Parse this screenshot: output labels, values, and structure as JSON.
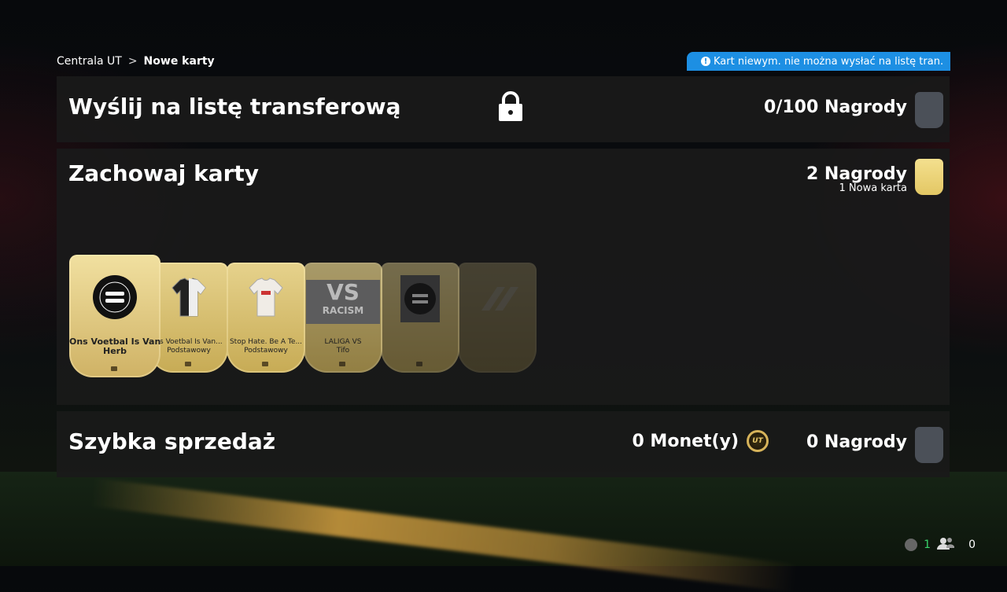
{
  "breadcrumb": {
    "root": "Centrala UT",
    "current": "Nowe karty"
  },
  "notice": {
    "text": "Kart niewym. nie można wysłać na listę tran."
  },
  "transfer_panel": {
    "title": "Wyślij na listę transferową",
    "rewards": "0/100 Nagrody",
    "locked": true
  },
  "keep_panel": {
    "title": "Zachowaj karty",
    "rewards": "2 Nagrody",
    "new_cards": "1 Nowa karta",
    "cards": [
      {
        "name": "Ons Voetbal Is Van...",
        "kind": "Herb",
        "image": "club-crest-icon"
      },
      {
        "name": "ns Voetbal Is Van...",
        "kind": "Podstawowy",
        "image": "kit-icon"
      },
      {
        "name": "Stop Hate. Be A Te...",
        "kind": "Podstawowy",
        "image": "kit-icon"
      },
      {
        "name": "LALIGA VS",
        "kind": "Tifo",
        "image": "vs-racism-tifo-icon",
        "tifo_text": "VS",
        "tifo_sub": "RACISM"
      },
      {
        "name": "",
        "kind": "",
        "image": "club-crest-icon"
      },
      {
        "name": "",
        "kind": "",
        "image": "stripes-icon"
      }
    ]
  },
  "quick_sell_panel": {
    "title": "Szybka sprzedaż",
    "coins": "0 Monet(y)",
    "coin_icon_label": "UT",
    "rewards": "0 Nagrody"
  },
  "footer": {
    "messages_count": "1",
    "friends_count": "0"
  },
  "colors": {
    "accent_blue": "#1d8fe3",
    "gold": "#e3c764",
    "panel": "#1a1a1a",
    "online_green": "#39d36b"
  }
}
